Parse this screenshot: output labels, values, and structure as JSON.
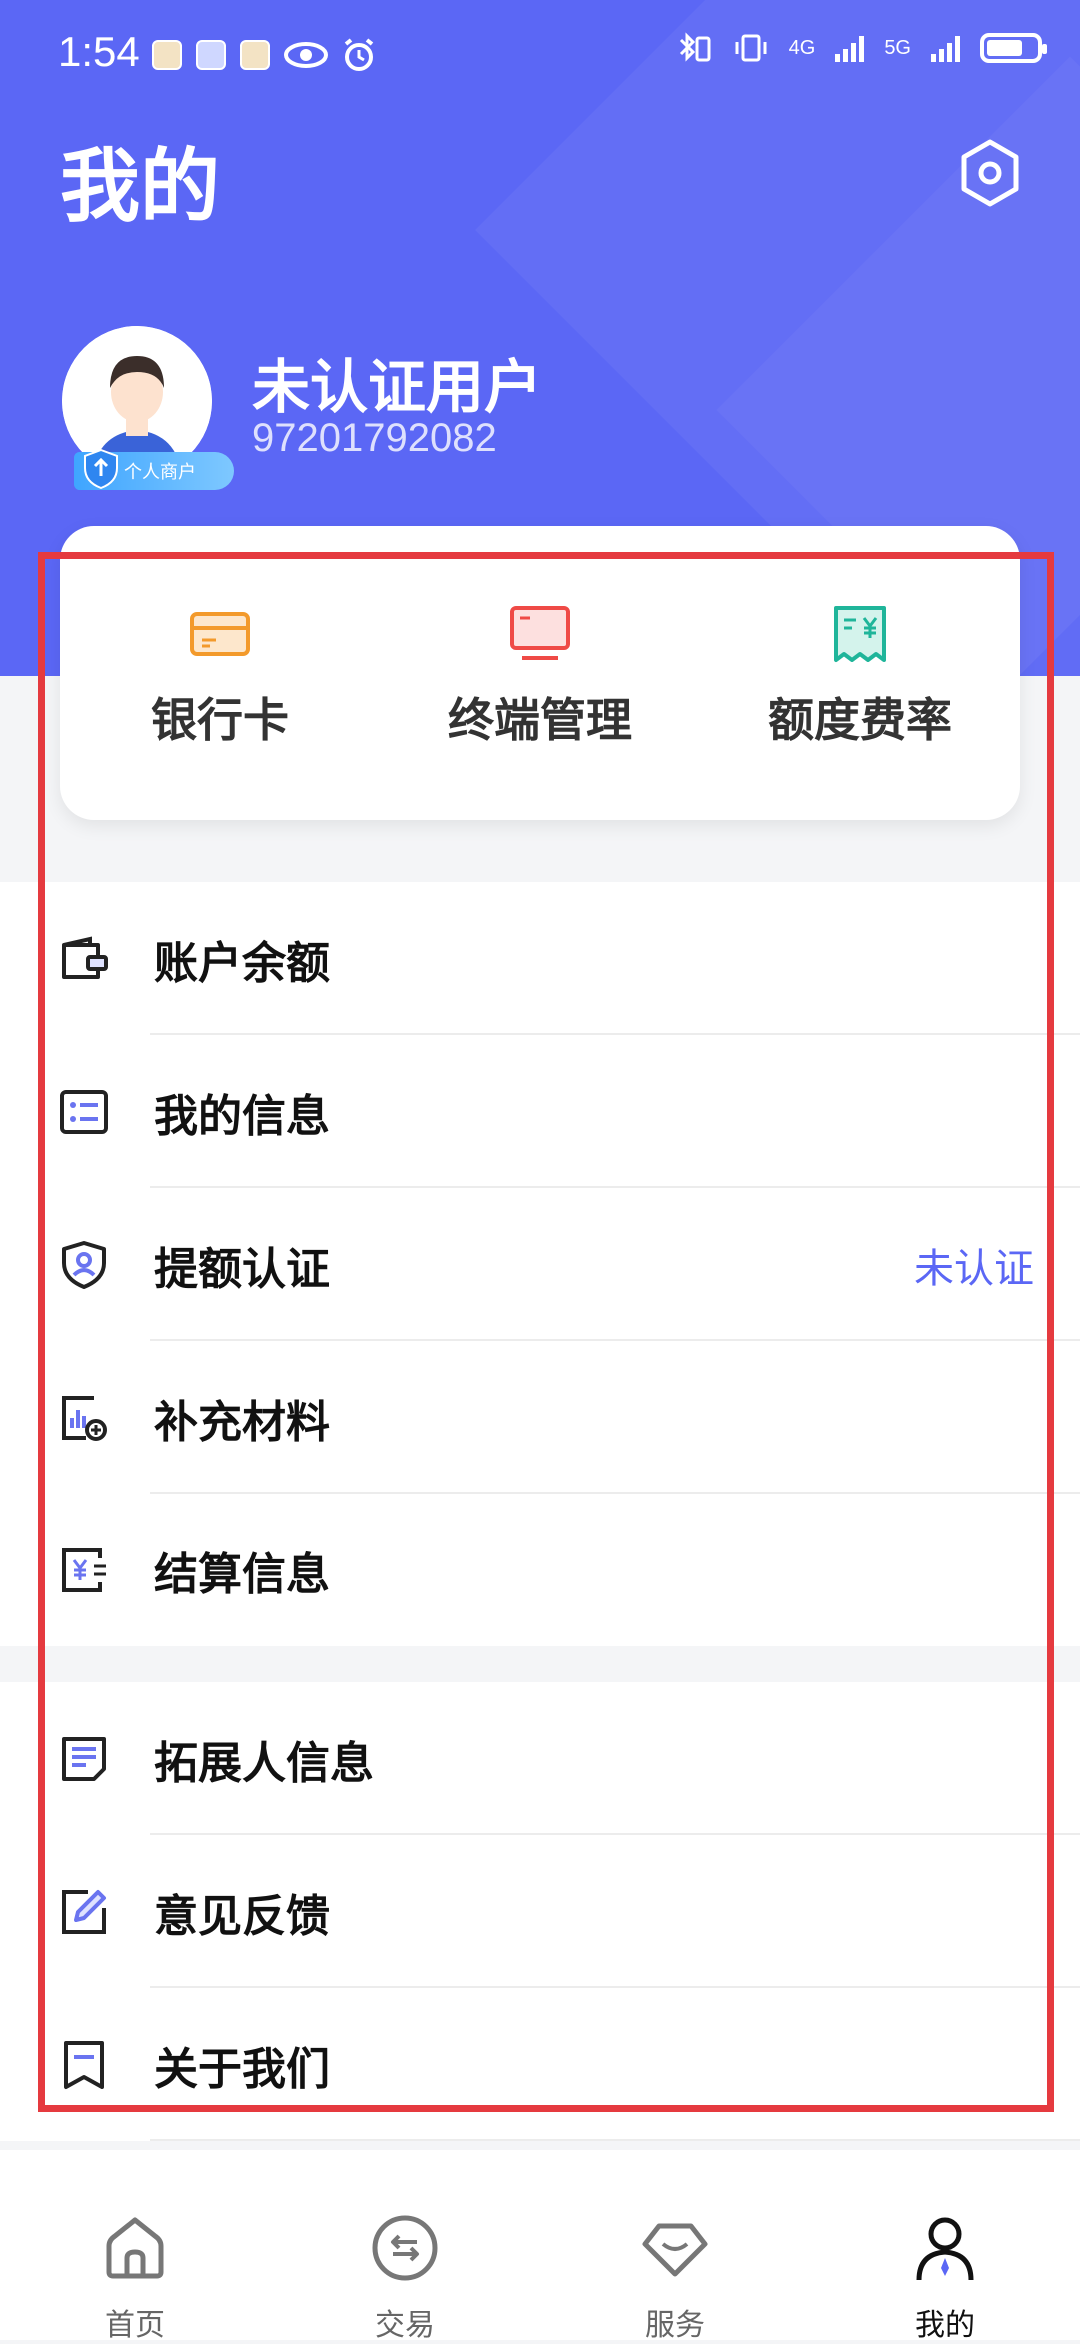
{
  "status_bar": {
    "time": "1:54",
    "net1": "4G",
    "net2": "5G"
  },
  "header": {
    "title": "我的"
  },
  "profile": {
    "name": "未认证用户",
    "id": "97201792082",
    "badge": "个人商户"
  },
  "quick_actions": [
    {
      "label": "银行卡",
      "icon": "bank-card-icon",
      "color": "#f39a2b"
    },
    {
      "label": "终端管理",
      "icon": "terminal-icon",
      "color": "#ef4a46"
    },
    {
      "label": "额度费率",
      "icon": "rate-receipt-icon",
      "color": "#1fb59a"
    }
  ],
  "menu": {
    "group1": [
      {
        "label": "账户余额",
        "icon": "wallet-icon"
      },
      {
        "label": "我的信息",
        "icon": "info-list-icon"
      },
      {
        "label": "提额认证",
        "icon": "shield-user-icon",
        "status": "未认证"
      },
      {
        "label": "补充材料",
        "icon": "chart-add-icon"
      },
      {
        "label": "结算信息",
        "icon": "settlement-icon"
      }
    ],
    "group2": [
      {
        "label": "拓展人信息",
        "icon": "document-icon"
      },
      {
        "label": "意见反馈",
        "icon": "edit-feedback-icon"
      },
      {
        "label": "关于我们",
        "icon": "bookmark-icon"
      }
    ]
  },
  "tabs": [
    {
      "label": "首页",
      "icon": "home-icon"
    },
    {
      "label": "交易",
      "icon": "exchange-icon"
    },
    {
      "label": "服务",
      "icon": "diamond-icon"
    },
    {
      "label": "我的",
      "icon": "person-icon",
      "active": true
    }
  ],
  "colors": {
    "brand": "#5b67f5",
    "highlight_frame": "#e53a3f"
  }
}
